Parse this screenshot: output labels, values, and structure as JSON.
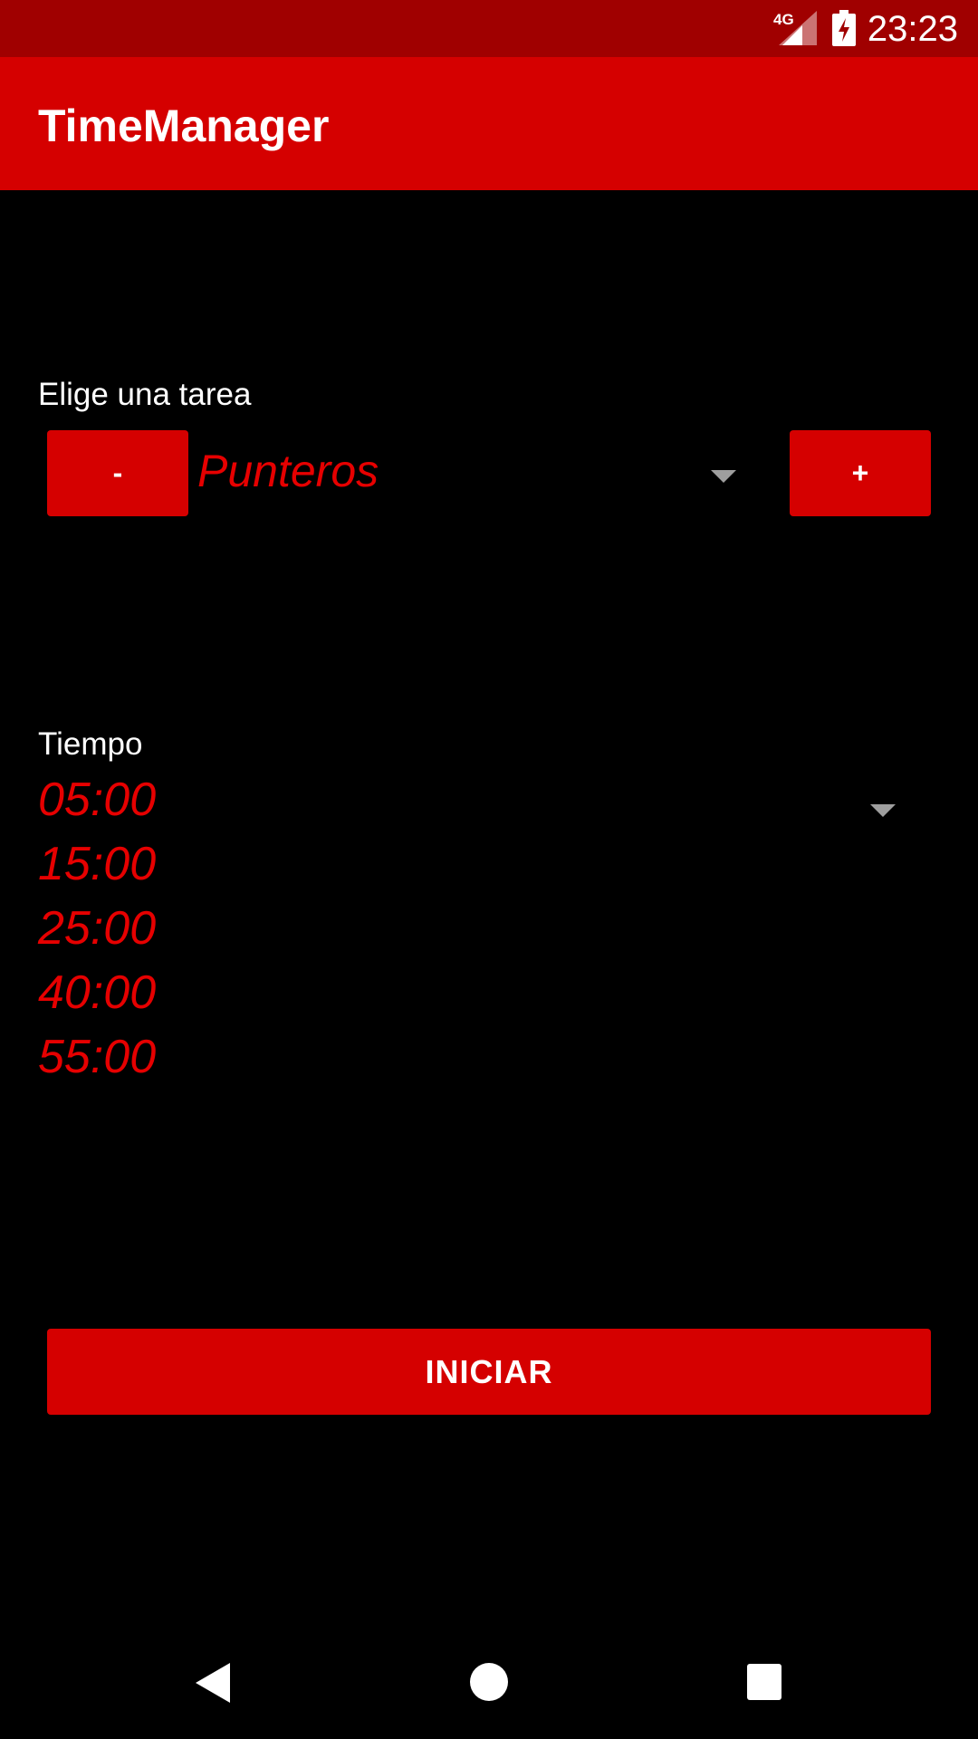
{
  "status_bar": {
    "network": "4G",
    "time": "23:23",
    "signal_icon": "signal-strength-icon",
    "battery_icon": "battery-charging-icon"
  },
  "app_bar": {
    "title": "TimeManager"
  },
  "task_section": {
    "label": "Elige una tarea",
    "selected_task": "Punteros",
    "remove_button_label": "-",
    "add_button_label": "+"
  },
  "time_section": {
    "label": "Tiempo",
    "options": [
      "05:00",
      "15:00",
      "25:00",
      "40:00",
      "55:00"
    ]
  },
  "start_button": {
    "label": "INICIAR"
  },
  "nav_bar": {
    "back_icon": "back-icon",
    "home_icon": "home-icon",
    "recents_icon": "recents-icon"
  },
  "colors": {
    "status_bar": "#a00000",
    "primary": "#d50000",
    "accent_text": "#e60000",
    "background": "#000000"
  }
}
